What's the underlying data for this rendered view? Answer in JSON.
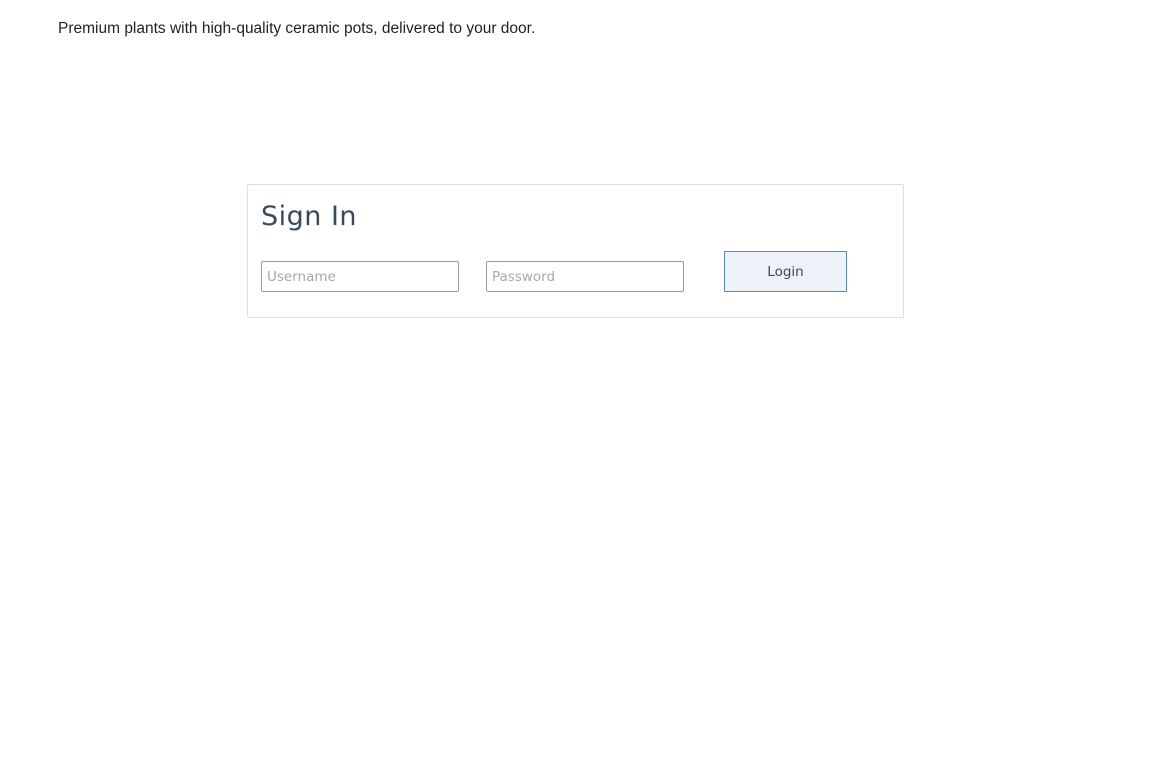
{
  "header": {
    "tagline": "Premium plants with high-quality ceramic pots, delivered to your door."
  },
  "signin": {
    "title": "Sign In",
    "username": {
      "placeholder": "Username",
      "value": ""
    },
    "password": {
      "placeholder": "Password",
      "value": ""
    },
    "login_label": "Login"
  },
  "colors": {
    "title": "#3a4a5c",
    "button_border": "#5b87b5",
    "button_bg": "#edf2f8",
    "card_border": "#dddddd"
  }
}
